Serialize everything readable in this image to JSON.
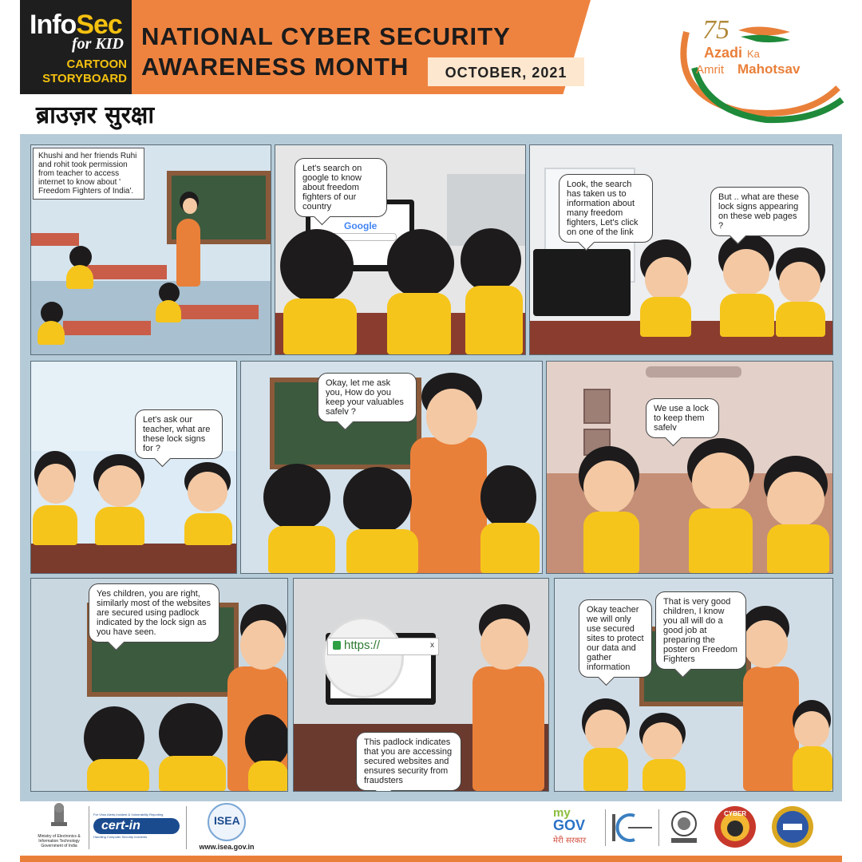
{
  "header": {
    "brand_line1a": "Info",
    "brand_line1b": "Sec",
    "brand_line2": "for KID",
    "brand_line3": "CARTOON",
    "brand_line4": "STORYBOARD",
    "title_line1": "NATIONAL CYBER SECURITY",
    "title_line2": "AWARENESS MONTH",
    "date": "OCTOBER, 2021",
    "azadi_number": "75",
    "azadi_line1": "Azadi",
    "azadi_ka": "Ka",
    "azadi_amrit": "Amrit",
    "azadi_mahotsav": "Mahotsav"
  },
  "page_title": "ब्राउज़र सुरक्षा",
  "panels": {
    "p1_caption": "Khushi and her friends Ruhi and rohit took permission from teacher to access internet to know about ' Freedom Fighters of India'.",
    "p2_bubble": "Let's search on google to know about freedom fighters of our country",
    "p2_google": "Google",
    "p3_bubble1": "Look, the search has taken us to information about many freedom fighters,  Let's click on one of the link",
    "p3_bubble2": "But .. what are these lock signs appearing on these web pages ?",
    "p4_bubble": "Let's ask our teacher, what are these lock signs for ?",
    "p5_bubble": "Okay,  let me ask you, How do you keep your valuables safely ?",
    "p6_bubble": "We use a lock to keep them safely",
    "p7_bubble": "Yes children, you are right, similarly most of the websites are secured using padlock indicated by the lock sign as you have seen.",
    "p8_url": "https://",
    "p8_close": "x",
    "p8_bubble": "This padlock indicates that you are accessing secured websites and ensures security from fraudsters",
    "p9_bubble1": "Okay teacher we will only use secured sites to protect our data and gather information",
    "p9_bubble2": "That is very good children, I know you all will do a good job at preparing the poster on Freedom Fighters"
  },
  "footer": {
    "ministry_line1": "Ministry of Electronics &",
    "ministry_line2": "Information Technology",
    "ministry_line3": "Government of India",
    "certin_tag": "For Virus Alerts,Incident & Vulnerability Reporting",
    "certin": "cert-in",
    "certin_sub": "Handling Computer Security Incidents",
    "isea": "ISEA",
    "isea_url": "www.isea.gov.in",
    "mygov_my": "my",
    "mygov_gov": "GOV",
    "mygov_hindi": "मेरी सरकार",
    "cyber": "CYBER"
  }
}
